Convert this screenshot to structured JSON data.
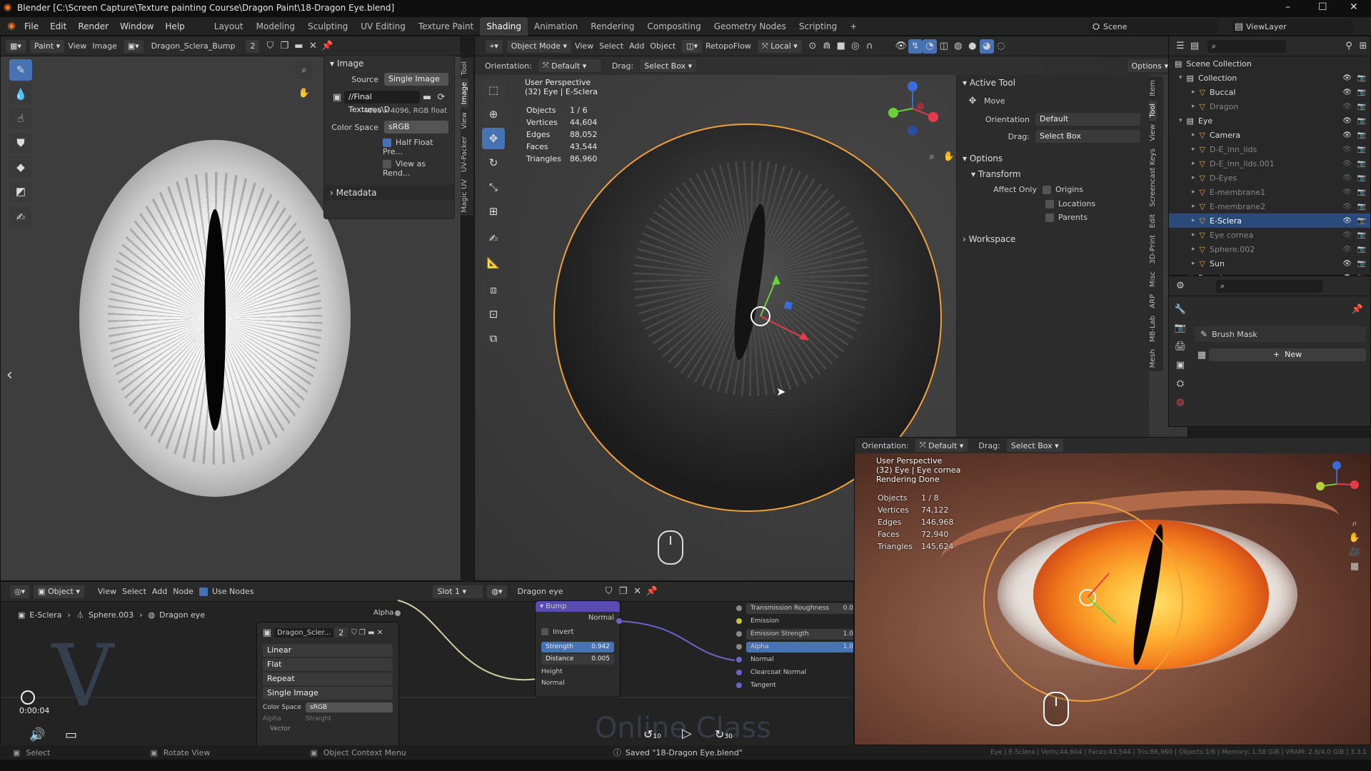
{
  "window": {
    "title": "Blender [C:\\Screen Capture\\Texture painting Course\\Dragon Paint\\18-Dragon Eye.blend]",
    "minimize": "–",
    "maximize": "☐",
    "close": "✕"
  },
  "menus": [
    "File",
    "Edit",
    "Render",
    "Window",
    "Help"
  ],
  "workspaces": [
    "Layout",
    "Modeling",
    "Sculpting",
    "UV Editing",
    "Texture Paint",
    "Shading",
    "Animation",
    "Rendering",
    "Compositing",
    "Geometry Nodes",
    "Scripting",
    "+"
  ],
  "active_workspace": "Shading",
  "scene": {
    "label": "Scene",
    "view_layer": "ViewLayer"
  },
  "image_editor": {
    "mode": "Paint",
    "view": "View",
    "image": "Image",
    "image_name": "Dragon_Sclera_Bump",
    "users": "2",
    "panel": {
      "title": "Image",
      "source_label": "Source",
      "source_value": "Single Image",
      "filepath": "//Final Textures\\D...",
      "info": "4096 x 4096,  RGB float",
      "colorspace_label": "Color Space",
      "colorspace_value": "sRGB",
      "half_float": "Half Float Pre...",
      "view_as_render": "View as Rend...",
      "metadata": "Metadata"
    },
    "side_tabs": [
      "Tool",
      "Image",
      "View",
      "UV-Packer",
      "Magic UV"
    ]
  },
  "viewport": {
    "header": {
      "mode": "Object Mode",
      "view": "View",
      "select": "Select",
      "add": "Add",
      "object": "Object",
      "retopoflow": "RetopoFlow",
      "transform": "Local"
    },
    "subheader": {
      "orientation_label": "Orientation:",
      "orientation_value": "Default",
      "drag_label": "Drag:",
      "drag_value": "Select Box",
      "options": "Options"
    },
    "overlay_title": "User Perspective",
    "overlay_sub": "(32) Eye | E-Sclera",
    "stats": [
      [
        "Objects",
        "1 / 6"
      ],
      [
        "Vertices",
        "44,604"
      ],
      [
        "Edges",
        "88,052"
      ],
      [
        "Faces",
        "43,544"
      ],
      [
        "Triangles",
        "86,960"
      ]
    ],
    "side_tabs": [
      "Item",
      "Tool",
      "View",
      "Screencast Keys",
      "Edit",
      "3D-Print",
      "Misc",
      "ARP",
      "MB-Lab",
      "Mesh"
    ]
  },
  "active_tool": {
    "title": "Active Tool",
    "tool": "Move",
    "orientation_label": "Orientation",
    "orientation_value": "Default",
    "drag_label": "Drag:",
    "drag_value": "Select Box",
    "options": "Options",
    "transform": "Transform",
    "affect_only": "Affect Only",
    "origins": "Origins",
    "locations": "Locations",
    "parents": "Parents",
    "workspace": "Workspace"
  },
  "outliner": {
    "title": "Scene Collection",
    "rows": [
      {
        "name": "Collection",
        "indent": 0,
        "dim": false,
        "sel": false
      },
      {
        "name": "Buccal",
        "indent": 1,
        "dim": false,
        "sel": false
      },
      {
        "name": "Dragon",
        "indent": 1,
        "dim": true,
        "sel": false
      },
      {
        "name": "Eye",
        "indent": 0,
        "dim": false,
        "sel": false
      },
      {
        "name": "Camera",
        "indent": 1,
        "dim": false,
        "sel": false
      },
      {
        "name": "D-E_inn_lids",
        "indent": 1,
        "dim": true,
        "sel": false
      },
      {
        "name": "D-E_inn_lids.001",
        "indent": 1,
        "dim": true,
        "sel": false
      },
      {
        "name": "D-Eyes",
        "indent": 1,
        "dim": true,
        "sel": false
      },
      {
        "name": "E-membrane1",
        "indent": 1,
        "dim": true,
        "sel": false
      },
      {
        "name": "E-membrane2",
        "indent": 1,
        "dim": true,
        "sel": false
      },
      {
        "name": "E-Sclera",
        "indent": 1,
        "dim": false,
        "sel": true
      },
      {
        "name": "Eye cornea",
        "indent": 1,
        "dim": true,
        "sel": false
      },
      {
        "name": "Sphere.002",
        "indent": 1,
        "dim": true,
        "sel": false
      },
      {
        "name": "Sun",
        "indent": 1,
        "dim": false,
        "sel": false
      },
      {
        "name": "Base human",
        "indent": 0,
        "dim": false,
        "sel": false
      }
    ]
  },
  "properties": {
    "brush_mask": "Brush Mask",
    "new": "New"
  },
  "node_editor": {
    "header": {
      "type": "Object",
      "view": "View",
      "select": "Select",
      "add": "Add",
      "node": "Node",
      "use_nodes": "Use Nodes",
      "slot": "Slot 1",
      "material": "Dragon eye"
    },
    "breadcrumb": [
      "E-Sclera",
      "Sphere.003",
      "Dragon eye"
    ],
    "image_node": {
      "name": "Dragon_Scler...",
      "users": "2",
      "interp": "Linear",
      "proj": "Flat",
      "ext": "Repeat",
      "src": "Single Image",
      "cs_label": "Color Space",
      "cs_value": "sRGB",
      "alpha": "Alpha",
      "straight": "Straight",
      "vector": "Vector",
      "alpha_out": "Alpha"
    },
    "bump_node": {
      "title": "Bump",
      "normal_out": "Normal",
      "invert": "Invert",
      "strength_label": "Strength",
      "strength": "0.942",
      "distance_label": "Distance",
      "distance": "0.005",
      "height": "Height",
      "normal_in": "Normal"
    },
    "bsdf_rows": [
      {
        "label": "Transmission Roughness",
        "value": "0.0"
      },
      {
        "label": "Emission",
        "value": ""
      },
      {
        "label": "Emission Strength",
        "value": "1.0"
      },
      {
        "label": "Alpha",
        "value": "1.0"
      },
      {
        "label": "Normal",
        "value": ""
      },
      {
        "label": "Clearcoat Normal",
        "value": ""
      },
      {
        "label": "Tangent",
        "value": ""
      }
    ],
    "watermark": "Online Class",
    "time": "0:00:04",
    "rewind": "10",
    "forward": "30"
  },
  "render_view": {
    "orientation_label": "Orientation:",
    "orientation_value": "Default",
    "drag_label": "Drag:",
    "drag_value": "Select Box",
    "overlay_title": "User Perspective",
    "overlay_sub": "(32) Eye | Eye cornea",
    "status": "Rendering Done",
    "stats": [
      [
        "Objects",
        "1 / 8"
      ],
      [
        "Vertices",
        "74,122"
      ],
      [
        "Edges",
        "146,968"
      ],
      [
        "Faces",
        "72,940"
      ],
      [
        "Triangles",
        "145,624"
      ]
    ]
  },
  "statusbar": {
    "select": "Select",
    "rotate": "Rotate View",
    "context": "Object Context Menu",
    "saved": "Saved \"18-Dragon Eye.blend\"",
    "stats": "Eye | E-Sclera | Verts:44,604 | Faces:43,544 | Tris:86,960 | Objects:1/6 | Memory: 1.58 GiB | VRAM: 2.6/4.0 GiB | 3.3.1"
  },
  "colors": {
    "accent": "#4772b3",
    "selection": "#e8a33c",
    "bg": "#1d1d1d",
    "panel": "#303030"
  }
}
